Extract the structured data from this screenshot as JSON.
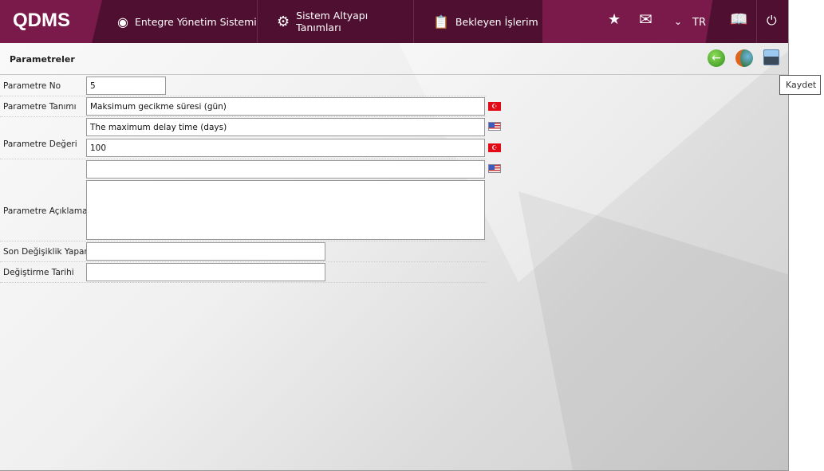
{
  "header": {
    "logo": "QDMS",
    "nav": [
      {
        "label": "Entegre Yönetim Sistemi",
        "icon": "q-logo-icon"
      },
      {
        "label": "Sistem Altyapı Tanımları",
        "icon": "gear-icon"
      },
      {
        "label": "Bekleyen İşlerim",
        "icon": "clipboard-check-icon"
      }
    ],
    "language": "TR",
    "colors": {
      "primary": "#7a1a4a",
      "dark": "#4f0f30"
    }
  },
  "panel": {
    "title": "Parametreler",
    "tooltip": "Kaydet"
  },
  "form": {
    "no_label": "Parametre No",
    "no_value": "5",
    "tanim_label": "Parametre Tanımı",
    "tanim_tr": "Maksimum gecikme süresi (gün)",
    "tanim_en": "The maximum delay time (days)",
    "deger_label": "Parametre Değeri",
    "deger_value": "100",
    "aciklama_label": "Parametre Açıklaması",
    "aciklama_en": "",
    "aciklama_tr": "",
    "yapan_label": "Son Değişiklik Yapan",
    "yapan_value": "",
    "tarih_label": "Değiştirme Tarihi",
    "tarih_value": ""
  }
}
